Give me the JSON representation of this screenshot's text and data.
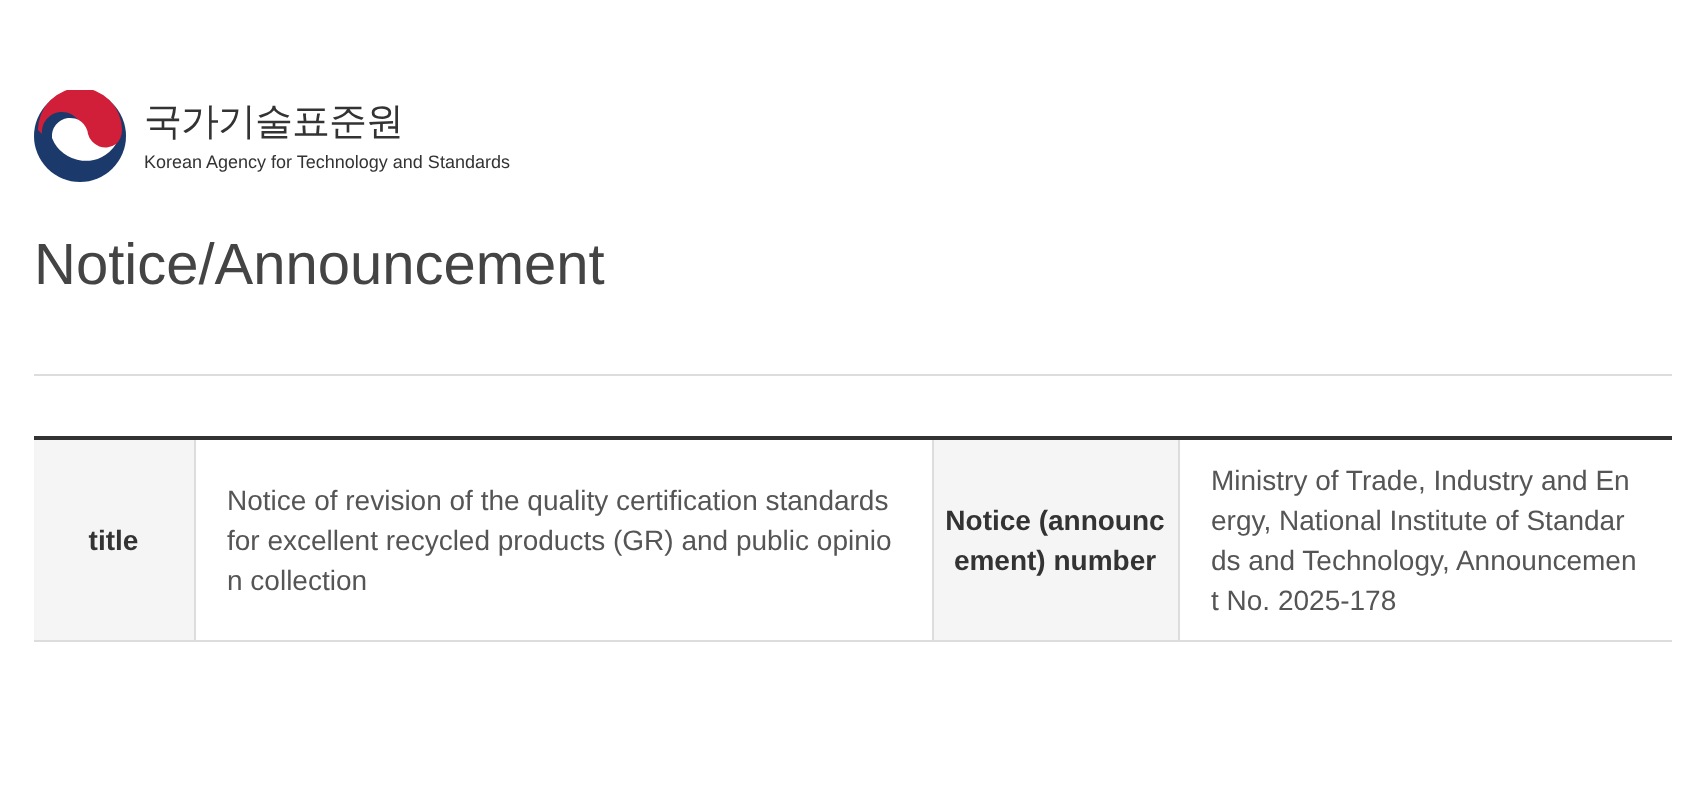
{
  "header": {
    "agency_name": "국가기술표준원",
    "agency_name_en": "Korean Agency for Technology and Standards"
  },
  "page_title": "Notice/Announcement",
  "table": {
    "rows": [
      {
        "cells": [
          {
            "kind": "header",
            "text": "title"
          },
          {
            "kind": "value",
            "text": "Notice of revision of the quality certification standards for excellent recycled products (GR) and public opinion collection"
          },
          {
            "kind": "header",
            "text": "Notice (announcement) number"
          },
          {
            "kind": "value",
            "text": "Ministry of Trade, Industry and Energy, National Institute of Standards and Technology, Announcement No. 2025-178"
          }
        ]
      }
    ]
  }
}
